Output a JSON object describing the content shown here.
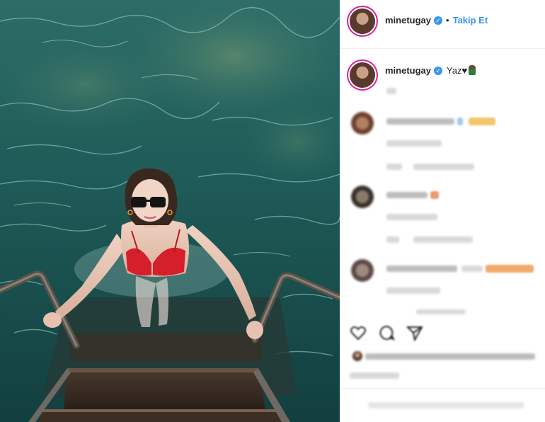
{
  "post": {
    "image_subject": "woman in red bikini on ladder in sea"
  },
  "header": {
    "username": "minetugay",
    "separator": "•",
    "follow_label": "Takip Et",
    "verified_icon": "verified-badge-icon"
  },
  "caption": {
    "username": "minetugay",
    "text": "Yaz♥"
  },
  "comments": [
    {
      "avatar": "blurred"
    },
    {
      "avatar": "blurred"
    },
    {
      "avatar": "blurred"
    }
  ],
  "actions": {
    "icons": [
      "heart-icon",
      "comment-icon",
      "share-icon"
    ]
  },
  "colors": {
    "link_blue": "#3897f0",
    "story_ring": "#d6249f",
    "water": "#1f5a55",
    "bikini": "#d51f2a"
  }
}
